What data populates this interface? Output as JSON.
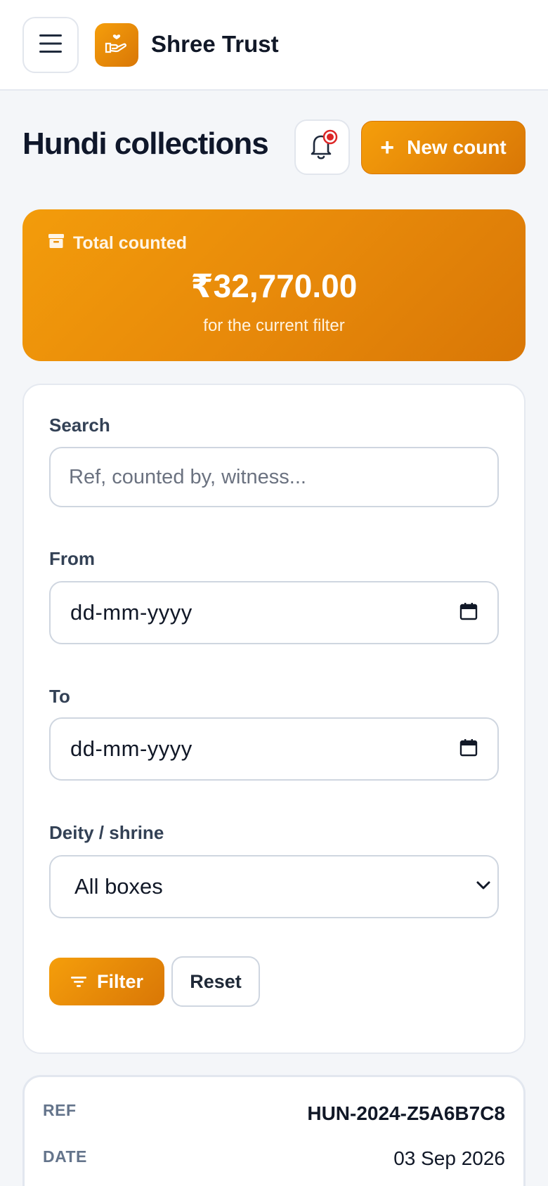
{
  "app": {
    "brand": "Shree Trust"
  },
  "header": {
    "title": "Hundi collections",
    "new_button_label": "New count"
  },
  "summary": {
    "label": "Total counted",
    "amount": "₹32,770.00",
    "subtitle": "for the current filter"
  },
  "filters": {
    "search_label": "Search",
    "search_placeholder": "Ref, counted by, witness...",
    "from_label": "From",
    "from_value": "dd-mm-yyyy",
    "to_label": "To",
    "to_value": "dd-mm-yyyy",
    "deity_label": "Deity / shrine",
    "deity_selected": "All boxes",
    "filter_button": "Filter",
    "reset_button": "Reset"
  },
  "records": [
    {
      "ref_label": "REF",
      "ref_value": "HUN-2024-Z5A6B7C8",
      "date_label": "DATE",
      "date_value": "03 Sep 2026"
    }
  ],
  "colors": {
    "accent": "#f59e0b",
    "accent_dark": "#d97706",
    "notification_dot": "#dc2626"
  }
}
